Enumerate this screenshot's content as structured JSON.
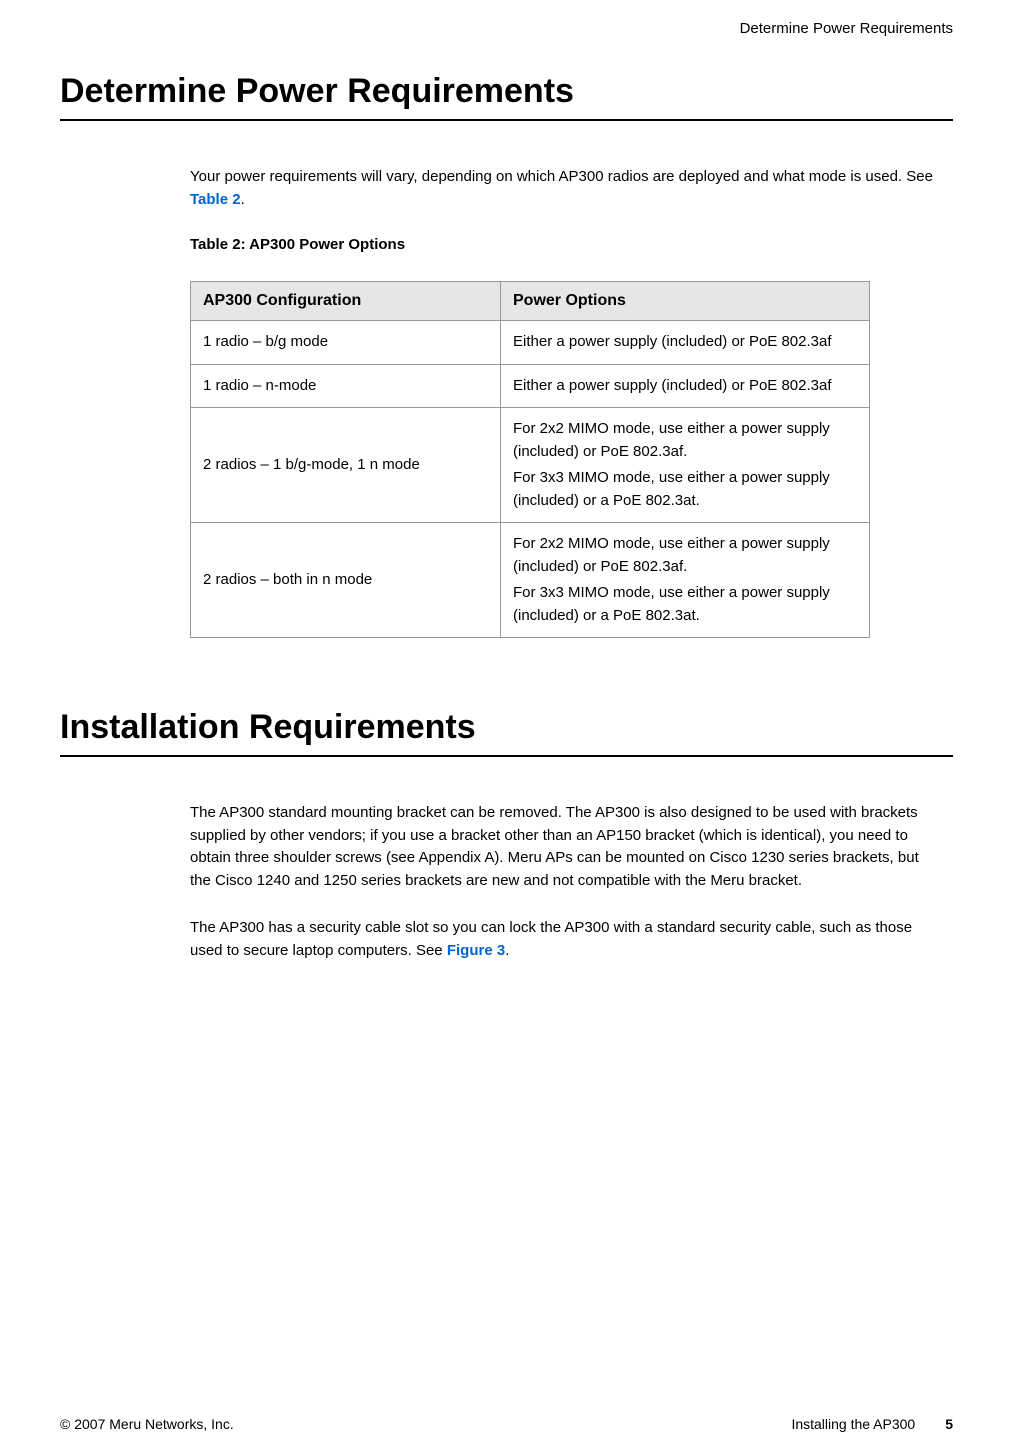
{
  "header": {
    "running_title": "Determine Power Requirements"
  },
  "section1": {
    "title": "Determine Power Requirements",
    "intro_before_link": "Your power requirements will vary, depending on which AP300 radios are deployed and what mode is used. See ",
    "intro_link": "Table 2",
    "intro_after_link": ".",
    "table_caption": "Table 2: AP300 Power Options",
    "table_headers": {
      "col1": "AP300 Configuration",
      "col2": "Power Options"
    },
    "table_rows": [
      {
        "config": "1 radio – b/g mode",
        "options": "Either a power supply (included) or PoE 802.3af"
      },
      {
        "config": "1 radio – n-mode",
        "options": "Either a power supply (included) or PoE 802.3af"
      },
      {
        "config": "2 radios – 1 b/g-mode, 1 n mode",
        "options_p1": "For 2x2 MIMO mode, use either a power supply (included) or PoE 802.3af.",
        "options_p2": "For 3x3 MIMO mode, use either a power supply (included) or a PoE 802.3at."
      },
      {
        "config": "2 radios – both in n mode",
        "options_p1": "For 2x2 MIMO mode, use either a power supply (included) or PoE 802.3af.",
        "options_p2": "For 3x3 MIMO mode, use either a power supply (included) or a PoE 802.3at."
      }
    ]
  },
  "section2": {
    "title": "Installation Requirements",
    "para1": "The AP300 standard mounting bracket can be removed. The AP300 is also designed to be used with brackets supplied by other vendors; if you use a bracket other than an AP150 bracket (which is identical), you need to obtain three shoulder screws (see Appendix A). Meru APs can be mounted on Cisco 1230 series brackets, but the Cisco 1240 and 1250 series brackets are new and not compatible with the Meru bracket.",
    "para2_before_link": "The AP300 has a security cable slot so you can lock the AP300 with a standard security cable, such as those used to secure laptop computers. See ",
    "para2_link": "Figure 3",
    "para2_after_link": "."
  },
  "footer": {
    "copyright": "© 2007 Meru Networks, Inc.",
    "doc_name": "Installing the AP300",
    "page": "5"
  }
}
